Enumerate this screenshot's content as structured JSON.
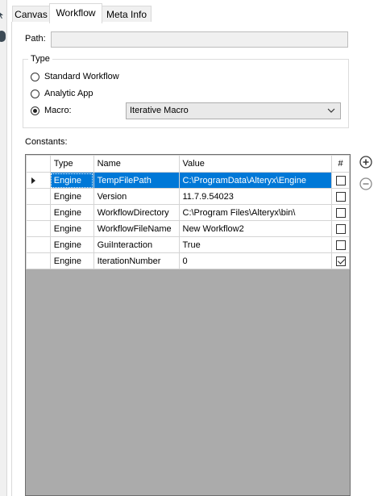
{
  "tabs": [
    {
      "label": "Canvas",
      "active": false
    },
    {
      "label": "Workflow",
      "active": true
    },
    {
      "label": "Meta Info",
      "active": false
    }
  ],
  "path": {
    "label": "Path:",
    "value": ""
  },
  "type_group": {
    "title": "Type",
    "options": [
      {
        "label": "Standard Workflow",
        "selected": false
      },
      {
        "label": "Analytic App",
        "selected": false
      },
      {
        "label": "Macro:",
        "selected": true
      }
    ],
    "macro_dropdown": {
      "selected": "Iterative Macro"
    }
  },
  "constants": {
    "label": "Constants:",
    "columns": [
      "Type",
      "Name",
      "Value",
      "#"
    ],
    "rows": [
      {
        "type": "Engine",
        "name": "TempFilePath",
        "value": "C:\\ProgramData\\Alteryx\\Engine",
        "checked": false,
        "selected": true
      },
      {
        "type": "Engine",
        "name": "Version",
        "value": "11.7.9.54023",
        "checked": false,
        "selected": false
      },
      {
        "type": "Engine",
        "name": "WorkflowDirectory",
        "value": "C:\\Program Files\\Alteryx\\bin\\",
        "checked": false,
        "selected": false
      },
      {
        "type": "Engine",
        "name": "WorkflowFileName",
        "value": "New Workflow2",
        "checked": false,
        "selected": false
      },
      {
        "type": "Engine",
        "name": "GuiInteraction",
        "value": "True",
        "checked": false,
        "selected": false
      },
      {
        "type": "Engine",
        "name": "IterationNumber",
        "value": "0",
        "checked": true,
        "selected": false
      }
    ]
  },
  "icons": {
    "add": "plus-circle-icon",
    "remove": "minus-circle-icon",
    "dropdown": "chevron-down-icon",
    "row_pointer": "row-pointer-icon"
  },
  "colors": {
    "selection": "#0078d7",
    "grid_background": "#ababab",
    "path_field": "#f0f0f0"
  }
}
